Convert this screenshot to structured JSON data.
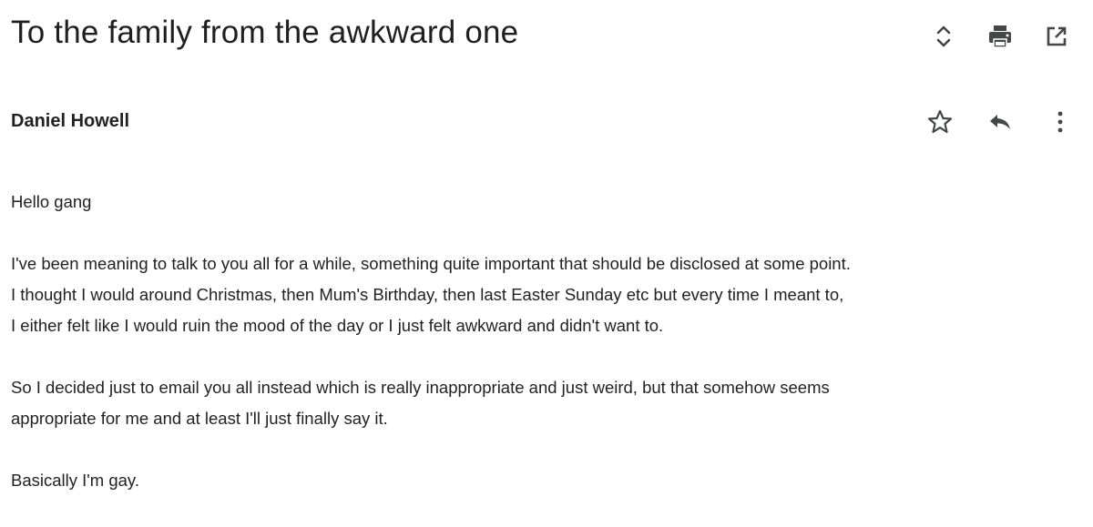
{
  "email": {
    "subject": "To the family from the awkward one",
    "sender": "Daniel Howell",
    "greeting": "Hello gang",
    "paragraphs": [
      "I've been meaning to talk to you all for a while, something quite important that should be disclosed at some point.\nI thought I would around Christmas, then Mum's Birthday, then last Easter Sunday etc but every time I meant to,\nI either felt like I would ruin the mood of the day or I just felt awkward and didn't want to.",
      "So I decided just to email you all instead which is really inappropriate and just weird, but that somehow seems\nappropriate for me and at least I'll just finally say it.",
      "Basically I'm gay."
    ]
  },
  "icons": {
    "header": [
      "expand-collapse-icon",
      "print-icon",
      "open-in-new-window-icon"
    ],
    "sender": [
      "star-icon",
      "reply-icon",
      "more-options-icon"
    ]
  },
  "colors": {
    "text": "#222222",
    "icon": "#444746"
  }
}
